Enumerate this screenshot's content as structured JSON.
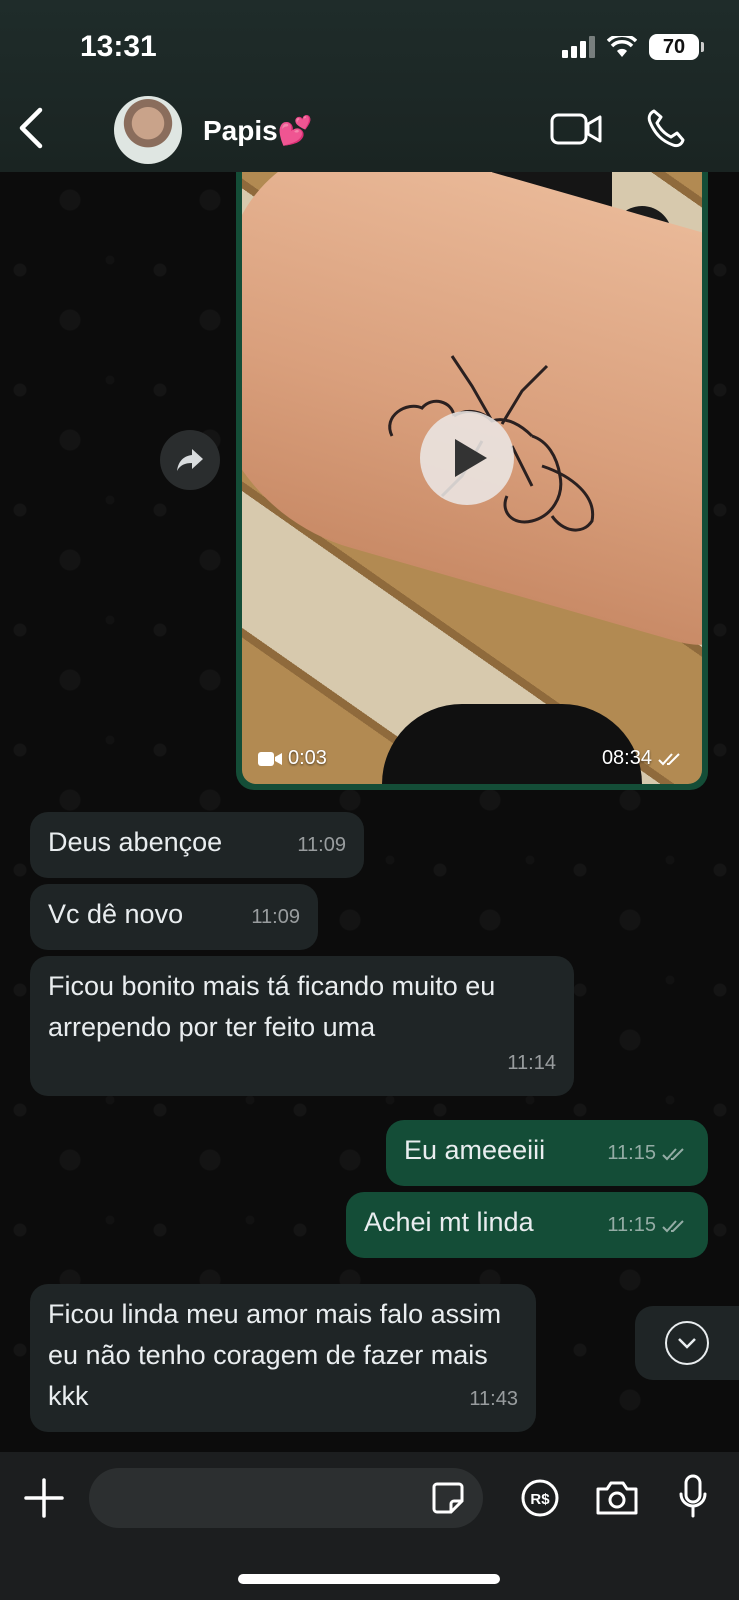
{
  "status_bar": {
    "time": "13:31",
    "battery": "70"
  },
  "header": {
    "contact_name": "Papis💕"
  },
  "video_message": {
    "duration": "0:03",
    "time": "08:34"
  },
  "messages": [
    {
      "text": "Deus abençoe",
      "time": "11:09"
    },
    {
      "text": "Vc dê novo",
      "time": "11:09"
    },
    {
      "text": "Ficou bonito mais tá ficando muito eu arrependo por ter feito uma",
      "time": "11:14"
    },
    {
      "text": "Eu ameeeiii",
      "time": "11:15"
    },
    {
      "text": "Achei mt linda",
      "time": "11:15"
    },
    {
      "text": "Ficou linda meu amor mais falo assim eu não tenho coragem de fazer mais kkk",
      "time": "11:43"
    }
  ],
  "composer": {
    "input_value": "",
    "icons": [
      "plus-icon",
      "sticker-icon",
      "payment-icon",
      "camera-icon",
      "microphone-icon"
    ]
  },
  "colors": {
    "incoming": "#1f2526",
    "outgoing": "#144d37",
    "header": "#1f2c2a"
  }
}
